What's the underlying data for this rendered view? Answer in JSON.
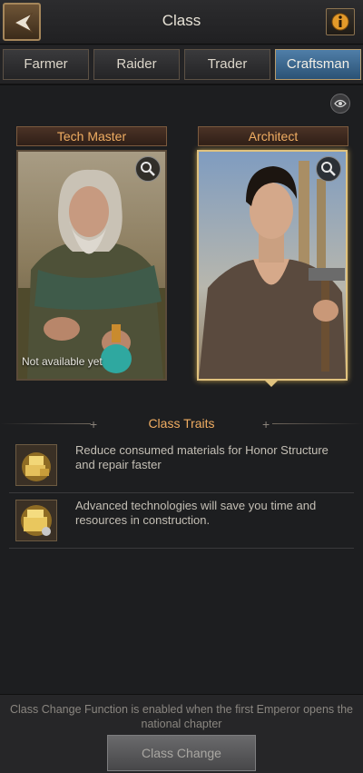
{
  "header": {
    "title": "Class"
  },
  "tabs": [
    {
      "label": "Farmer"
    },
    {
      "label": "Raider"
    },
    {
      "label": "Trader"
    },
    {
      "label": "Craftsman",
      "active": true
    }
  ],
  "cards": [
    {
      "label": "Tech Master",
      "status": "Not available yet",
      "selected": false
    },
    {
      "label": "Architect",
      "selected": true
    }
  ],
  "traits": {
    "title": "Class Traits",
    "items": [
      {
        "text": "Reduce consumed materials for Honor Structure and repair faster"
      },
      {
        "text": "Advanced technologies will save you time and resources in construction."
      }
    ]
  },
  "footer": {
    "note": "Class Change Function is enabled when the first Emperor opens the national chapter",
    "button_label": "Class Change"
  },
  "colors": {
    "accent": "#f0ad62",
    "active_tab": "#3d6b94",
    "selected_border": "#e0c27e"
  }
}
